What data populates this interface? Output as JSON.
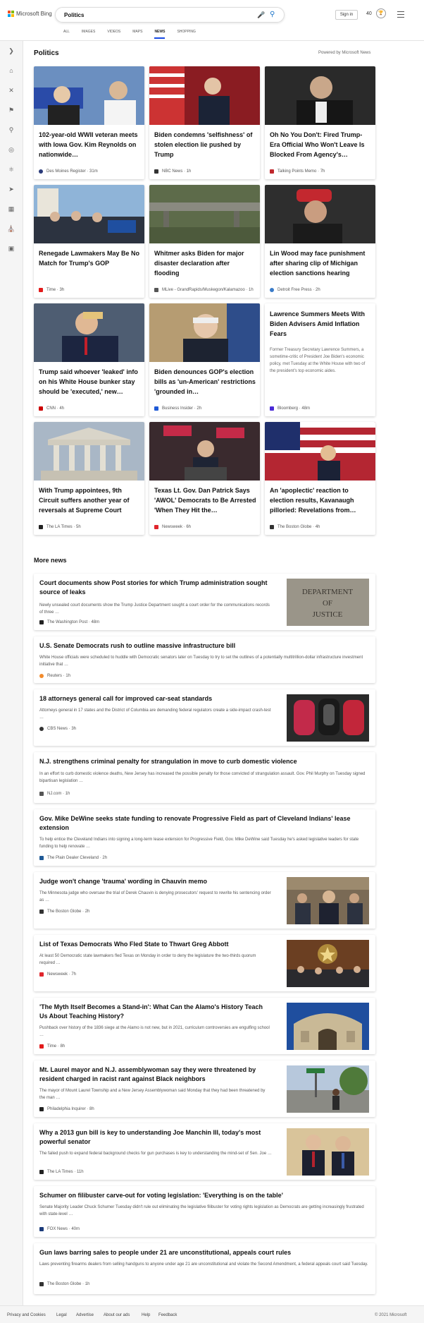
{
  "header": {
    "brand": "Microsoft Bing",
    "query": "Politics",
    "signin": "Sign in",
    "points": "40",
    "tabs": [
      "ALL",
      "IMAGES",
      "VIDEOS",
      "MAPS",
      "NEWS",
      "SHOPPING"
    ],
    "active_tab": "NEWS"
  },
  "section_title": "Politics",
  "powered_by": "Powered by Microsoft News",
  "cards": [
    {
      "headline": "102-year-old WWII veteran meets with Iowa Gov. Kim Reynolds on nationwide…",
      "source": "Des Moines Register · 31m",
      "color": "#2b3b7a"
    },
    {
      "headline": "Biden condemns 'selfishness' of stolen election lie pushed by Trump",
      "source": "NBC News · 1h",
      "color": "#333"
    },
    {
      "headline": "Oh No You Don't: Fired Trump-Era Official Who Won't Leave Is Blocked From Agency's…",
      "source": "Talking Points Memo · 7h",
      "color": "#c0282d"
    },
    {
      "headline": "Renegade Lawmakers May Be No Match for Trump's GOP",
      "source": "Time · 3h",
      "color": "#e21b1b"
    },
    {
      "headline": "Whitmer asks Biden for major disaster declaration after flooding",
      "source": "MLive - GrandRapids/Muskegon/Kalamazoo · 1h",
      "color": "#555"
    },
    {
      "headline": "Lin Wood may face punishment after sharing clip of Michigan election sanctions hearing",
      "source": "Detroit Free Press · 2h",
      "color": "#3a7bc8"
    },
    {
      "headline": "Trump said whoever 'leaked' info on his White House bunker stay should be 'executed,' new…",
      "source": "CNN · 4h",
      "color": "#cc0000"
    },
    {
      "headline": "Biden denounces GOP's election bills as 'un-American' restrictions 'grounded in…",
      "source": "Business Insider · 2h",
      "color": "#1f5ad6"
    },
    {
      "headline": "Lawrence Summers Meets With Biden Advisers Amid Inflation Fears",
      "snippet": "Former Treasury Secretary Lawrence Summers, a sometime-critic of President Joe Biden's economic policy, met Tuesday at the White House with two of the president's top economic aides.",
      "source": "Bloomberg · 48m",
      "color": "#4a2ad6"
    },
    {
      "headline": "With Trump appointees, 9th Circuit suffers another year of reversals at Supreme Court",
      "source": "The LA Times · 5h",
      "color": "#222"
    },
    {
      "headline": "Texas Lt. Gov. Dan Patrick Says 'AWOL' Democrats to Be Arrested 'When They Hit the…",
      "source": "Newsweek · 6h",
      "color": "#e0262d"
    },
    {
      "headline": "An 'apoplectic' reaction to election results, Kavanaugh pilloried: Revelations from…",
      "source": "The Boston Globe · 4h",
      "color": "#333"
    }
  ],
  "more_title": "More news",
  "news": [
    {
      "headline": "Court documents show Post stories for which Trump administration sought source of leaks",
      "snippet": "Newly unsealed court documents show the Trump Justice Department sought a court order for the communications records of three …",
      "source": "The Washington Post · 48m",
      "color": "#222",
      "thumb": "doj"
    },
    {
      "headline": "U.S. Senate Democrats rush to outline massive infrastructure bill",
      "snippet": "White House officials were scheduled to huddle with Democratic senators later on Tuesday to try to set the outlines of a potentially multitrillion-dollar infrastructure investment initiative that …",
      "source": "Reuters · 1h",
      "color": "#f28b2c"
    },
    {
      "headline": "18 attorneys general call for improved car-seat standards",
      "snippet": "Attorneys general in 17 states and the District of Columbia are demanding federal regulators create a side-impact crash-test …",
      "source": "CBS News · 3h",
      "color": "#333",
      "thumb": "seats"
    },
    {
      "headline": "N.J. strengthens criminal penalty for strangulation in move to curb domestic violence",
      "snippet": "In an effort to curb domestic violence deaths, New Jersey has increased the possible penalty for those convicted of strangulation assault. Gov. Phil Murphy on Tuesday signed bipartisan legislation …",
      "source": "NJ.com · 1h",
      "color": "#555"
    },
    {
      "headline": "Gov. Mike DeWine seeks state funding to renovate Progressive Field as part of Cleveland Indians' lease extension",
      "snippet": "To help entice the Cleveland Indians into signing a long-term lease extension for Progressive Field, Gov. Mike DeWine said Tuesday he's asked legislative leaders for state funding to help renovate …",
      "source": "The Plain Dealer Cleveland · 2h",
      "color": "#1f5a96"
    },
    {
      "headline": "Judge won't change 'trauma' wording in Chauvin memo",
      "snippet": "The Minnesota judge who oversaw the trial of Derek Chauvin is denying prosecutors' request to rewrite his sentencing order as …",
      "source": "The Boston Globe · 2h",
      "color": "#333",
      "thumb": "judge"
    },
    {
      "headline": "List of Texas Democrats Who Fled State to Thwart Greg Abbott",
      "snippet": "At least 50 Democratic state lawmakers fled Texas on Monday in order to deny the legislature the two-thirds quorum required …",
      "source": "Newsweek · 7h",
      "color": "#e0262d",
      "thumb": "texas"
    },
    {
      "headline": "'The Myth Itself Becomes a Stand-in': What Can the Alamo's History Teach Us About Teaching History?",
      "snippet": "Pushback over history of the 1836 siege at the Alamo is not new, but in 2021, curriculum controversies are engulfing school …",
      "source": "Time · 8h",
      "color": "#e21b1b",
      "thumb": "alamo"
    },
    {
      "headline": "Mt. Laurel mayor and N.J. assemblywoman say they were threatened by resident charged in racist rant against Black neighbors",
      "snippet": "The mayor of Mount Laurel Township and a New Jersey Assemblywoman said Monday that they had been threatened by the man …",
      "source": "Philadelphia Inquirer · 8h",
      "color": "#222",
      "thumb": "street"
    },
    {
      "headline": "Why a 2013 gun bill is key to understanding Joe Manchin III, today's most powerful senator",
      "snippet": "The failed push to expand federal background checks for gun purchases is key to understanding the mind-set of Sen. Joe …",
      "source": "The LA Times · 11h",
      "color": "#222",
      "thumb": "manchin"
    },
    {
      "headline": "Schumer on filibuster carve-out for voting legislation: 'Everything is on the table'",
      "snippet": "Senate Majority Leader Chuck Schumer Tuesday didn't rule out eliminating the legislative filibuster for voting rights legislation as Democrats are getting increasingly frustrated with state-level …",
      "source": "FOX News · 40m",
      "color": "#1b3a7a"
    },
    {
      "headline": "Gun laws barring sales to people under 21 are unconstitutional, appeals court rules",
      "snippet": "Laws preventing firearms dealers from selling handguns to anyone under age 21 are unconstitutional and violate the Second Amendment, a federal appeals court said Tuesday.",
      "source": "The Boston Globe · 1h",
      "color": "#333"
    }
  ],
  "footer": {
    "links": [
      "Privacy and Cookies",
      "Legal",
      "Advertise",
      "About our ads",
      "Help",
      "Feedback"
    ],
    "copyright": "© 2021 Microsoft"
  }
}
